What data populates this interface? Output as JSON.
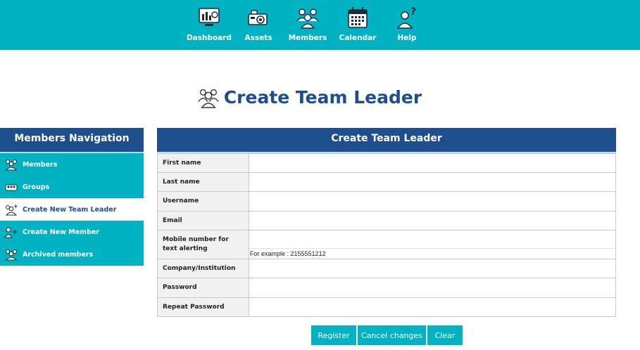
{
  "topnav": {
    "items": [
      {
        "label": "Dashboard",
        "icon": "dashboard-icon"
      },
      {
        "label": "Assets",
        "icon": "assets-icon"
      },
      {
        "label": "Members",
        "icon": "members-icon"
      },
      {
        "label": "Calendar",
        "icon": "calendar-icon"
      },
      {
        "label": "Help",
        "icon": "help-icon"
      }
    ]
  },
  "page": {
    "title": "Create Team Leader"
  },
  "sidebar": {
    "title": "Members Navigation",
    "items": [
      {
        "label": "Members",
        "active": false
      },
      {
        "label": "Groups",
        "active": false
      },
      {
        "label": "Create New Team Leader",
        "active": true
      },
      {
        "label": "Create New Member",
        "active": false
      },
      {
        "label": "Archived members",
        "active": false
      }
    ]
  },
  "form": {
    "title": "Create Team Leader",
    "fields": [
      {
        "label": "First name",
        "value": ""
      },
      {
        "label": "Last name",
        "value": ""
      },
      {
        "label": "Username",
        "value": ""
      },
      {
        "label": "Email",
        "value": ""
      },
      {
        "label": "Mobile number for text alerting",
        "value": "",
        "hint": "For example : 2155551212"
      },
      {
        "label": "Company/Institution",
        "value": ""
      },
      {
        "label": "Password",
        "value": ""
      },
      {
        "label": "Repeat Password",
        "value": ""
      }
    ],
    "buttons": {
      "register": "Register",
      "cancel": "Cancel changes",
      "clear": "Clear"
    }
  },
  "colors": {
    "teal": "#00b2c2",
    "navy": "#1f4e8c"
  }
}
